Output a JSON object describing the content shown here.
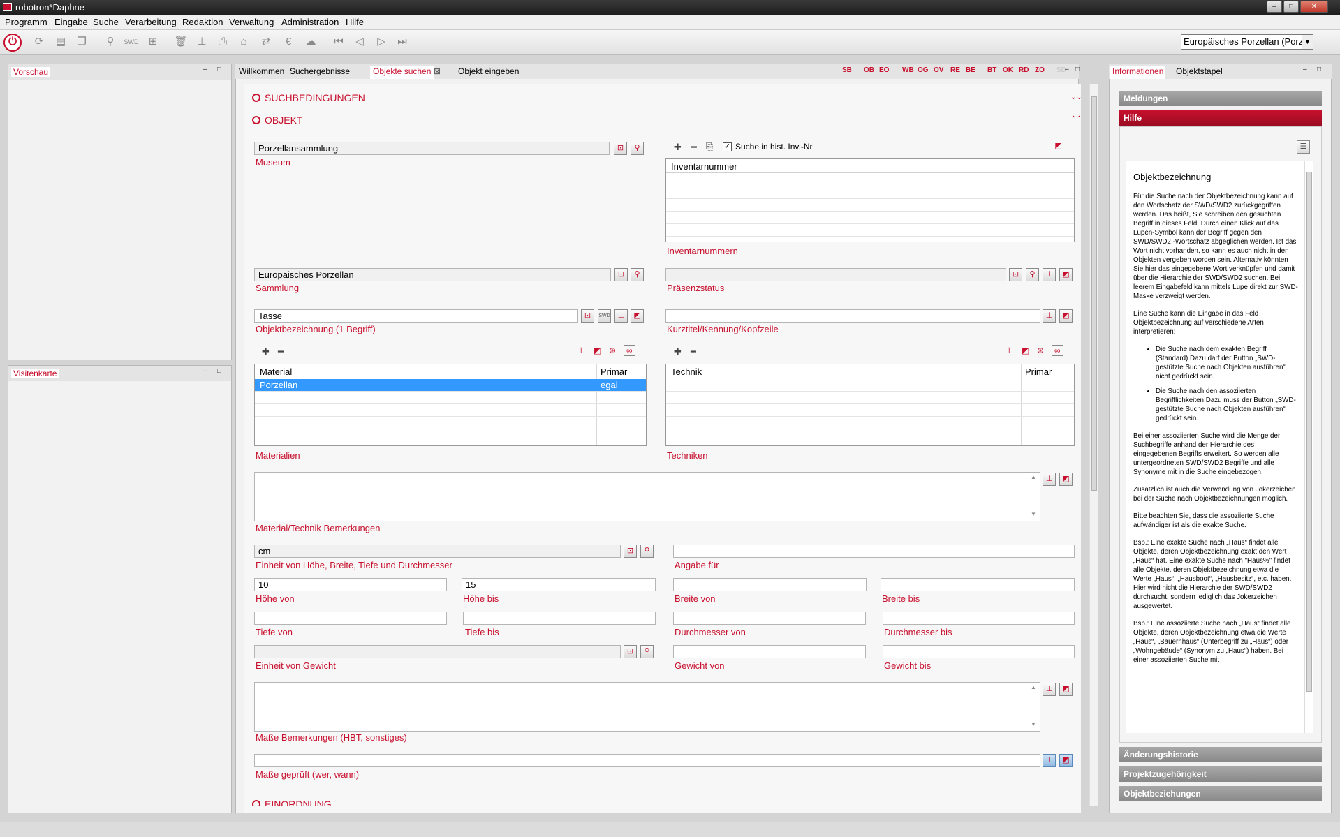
{
  "window": {
    "title": "robotron*Daphne",
    "min": "‒",
    "max": "□",
    "close": "✕"
  },
  "menu": [
    "Programm",
    "Eingabe",
    "Suche",
    "Verarbeitung",
    "Redaktion",
    "Verwaltung",
    "Administration",
    "Hilfe"
  ],
  "toolbar": {
    "collection_select": "Europäisches Porzellan (Porzellan"
  },
  "left": {
    "preview_tab": "Vorschau",
    "card_tab": "Visitenkarte"
  },
  "center": {
    "tabs": [
      "Willkommen",
      "Suchergebnisse",
      "Objekte suchen",
      "Objekt eingeben"
    ],
    "status_tabs": [
      "SB",
      "OB",
      "EO",
      "WB",
      "OG",
      "OV",
      "RE",
      "BE",
      "BT",
      "OK",
      "RD",
      "ZO",
      "SD"
    ],
    "sections": {
      "conditions": "SUCHBEDINGUNGEN",
      "object": "OBJEKT",
      "classification": "EINORDNUNG"
    },
    "museum": {
      "value": "Porzellansammlung",
      "label": "Museum"
    },
    "inv": {
      "checkbox_label": "Suche in hist. Inv.-Nr.",
      "header": "Inventarnummer",
      "label": "Inventarnummern"
    },
    "collection": {
      "value": "Europäisches Porzellan",
      "label": "Sammlung"
    },
    "presence": {
      "label": "Präsenzstatus"
    },
    "designation": {
      "value": "Tasse",
      "label": "Objektbezeichnung (1 Begriff)"
    },
    "shorttitle": {
      "label": "Kurztitel/Kennung/Kopfzeile"
    },
    "materials": {
      "col1": "Material",
      "col2": "Primär",
      "row_material": "Porzellan",
      "row_primary": "egal",
      "label": "Materialien"
    },
    "techniques": {
      "col1": "Technik",
      "col2": "Primär",
      "label": "Techniken"
    },
    "mat_remarks": {
      "label": "Material/Technik Bemerkungen"
    },
    "unit": {
      "value": "cm",
      "label": "Einheit von Höhe, Breite, Tiefe und Durchmesser"
    },
    "spec": {
      "label": "Angabe für"
    },
    "height_from": {
      "value": "10",
      "label": "Höhe von"
    },
    "height_to": {
      "value": "15",
      "label": "Höhe bis"
    },
    "width_from": {
      "label": "Breite von"
    },
    "width_to": {
      "label": "Breite bis"
    },
    "depth_from": {
      "label": "Tiefe von"
    },
    "depth_to": {
      "label": "Tiefe bis"
    },
    "diam_from": {
      "label": "Durchmesser von"
    },
    "diam_to": {
      "label": "Durchmesser bis"
    },
    "weight_unit": {
      "label": "Einheit von Gewicht"
    },
    "weight_from": {
      "label": "Gewicht von"
    },
    "weight_to": {
      "label": "Gewicht bis"
    },
    "dim_remarks": {
      "label": "Maße Bemerkungen (HBT, sonstiges)"
    },
    "dim_checked": {
      "label": "Maße geprüft (wer, wann)"
    }
  },
  "right": {
    "tabs": [
      "Informationen",
      "Objektstapel"
    ],
    "sections": [
      "Meldungen",
      "Hilfe",
      "Änderungshistorie",
      "Projektzugehörigkeit",
      "Objektbeziehungen"
    ],
    "help": {
      "title": "Objektbezeichnung",
      "p1": "Für die Suche nach der Objektbezeichnung kann auf den Wortschatz der SWD/SWD2 zurückgegriffen werden. Das heißt, Sie schreiben den gesuchten Begriff in dieses Feld. Durch einen Klick auf das Lupen-Symbol kann der Begriff gegen den SWD/SWD2 -Wortschatz abgeglichen werden. Ist das Wort nicht vorhanden, so kann es auch nicht in den Objekten vergeben worden sein. Alternativ könnten Sie hier das eingegebene Wort verknüpfen und damit über die Hierarchie der SWD/SWD2 suchen. Bei leerem Eingabefeld kann mittels Lupe direkt zur SWD-Maske verzweigt werden.",
      "p2": "Eine Suche kann die Eingabe in das Feld Objektbezeichnung auf verschiedene Arten interpretieren:",
      "li1": "Die Suche nach dem exakten Begriff (Standard) Dazu darf der Button „SWD-gestützte Suche nach Objekten ausführen“ nicht gedrückt sein.",
      "li2": "Die Suche nach den assoziierten Begrifflichkeiten Dazu muss der Button „SWD-gestützte Suche nach Objekten ausführen“ gedrückt sein.",
      "p3": "Bei einer assoziierten Suche wird die Menge der Suchbegriffe anhand der Hierarchie des eingegebenen Begriffs erweitert. So werden alle untergeordneten SWD/SWD2 Begriffe und alle Synonyme mit in die Suche eingebezogen.",
      "p4": "Zusätzlich ist auch die Verwendung von Jokerzeichen bei der Suche nach Objektbezeichnungen möglich.",
      "p5": "Bitte beachten Sie, dass die assoziierte Suche aufwändiger ist als die exakte Suche.",
      "p6": "Bsp.: Eine exakte Suche nach „Haus“ findet alle Objekte, deren Objektbezeichnung exakt den Wert „Haus“ hat. Eine exakte Suche nach \"Haus%\" findet alle Objekte, deren Objektbezeichnung etwa die Werte „Haus“, „Hausboot“, „Hausbesitz“, etc. haben. Hier wird nicht die Hierarchie der SWD/SWD2 durchsucht, sondern lediglich das Jokerzeichen ausgewertet.",
      "p7": "Bsp.: Eine assoziierte Suche nach „Haus“ findet alle Objekte, deren Objektbezeichnung etwa die Werte „Haus“, „Bauernhaus“ (Unterbegriff zu „Haus“) oder „Wohngebäude“ (Synonym zu „Haus“) haben. Bei einer assoziierten Suche mit"
    }
  }
}
